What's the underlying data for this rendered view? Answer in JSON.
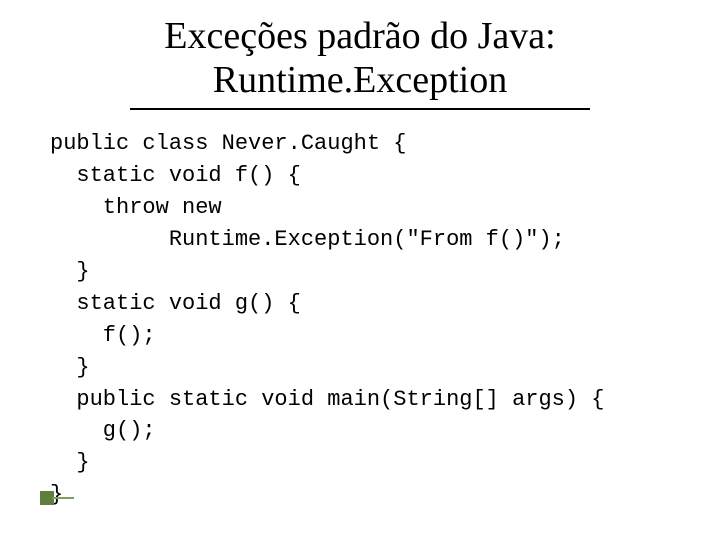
{
  "title": {
    "line1": "Exceções padrão do Java:",
    "line2": "Runtime.Exception"
  },
  "code": {
    "l1": "public class Never.Caught {",
    "l2": "  static void f() {",
    "l3": "    throw new",
    "l4": "         Runtime.Exception(\"From f()\");",
    "l5": "  }",
    "l6": "  static void g() {",
    "l7": "    f();",
    "l8": "  }",
    "l9": "  public static void main(String[] args) {",
    "l10": "    g();",
    "l11": "  }",
    "l12": "}"
  }
}
